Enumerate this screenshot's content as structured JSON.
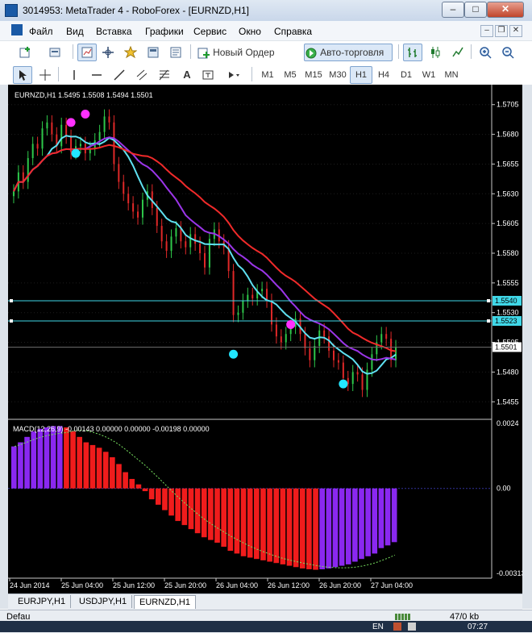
{
  "window": {
    "title": "3014953: MetaTrader 4 - RoboForex - [EURNZD,H1]",
    "controls": {
      "minimize": "–",
      "maximize": "□",
      "close": "✕"
    }
  },
  "menu": {
    "items": [
      "Файл",
      "Вид",
      "Вставка",
      "Графики",
      "Сервис",
      "Окно",
      "Справка"
    ],
    "mdi": {
      "minimize": "–",
      "restore": "❐",
      "close": "✕"
    }
  },
  "toolbar1": {
    "new_order": "Новый Ордер",
    "autotrade": "Авто-торговля"
  },
  "toolbar2": {
    "timeframes": [
      "M1",
      "M5",
      "M15",
      "M30",
      "H1",
      "H4",
      "D1",
      "W1",
      "MN"
    ],
    "active_timeframe": "H1",
    "text_tool": "A"
  },
  "chart": {
    "header": "EURNZD,H1  1.5495 1.5508 1.5494 1.5501",
    "price_axis": [
      "1.5705",
      "1.5680",
      "1.5655",
      "1.5630",
      "1.5605",
      "1.5580",
      "1.5555",
      "1.5530",
      "1.5505",
      "1.5480",
      "1.5455"
    ],
    "price_min": 1.5445,
    "price_max": 1.5715,
    "hlines": [
      {
        "price": 1.554,
        "label": "1.5540",
        "color": "#40d8e8"
      },
      {
        "price": 1.5523,
        "label": "1.5523",
        "color": "#40d8e8"
      }
    ],
    "current_price": {
      "price": 1.5501,
      "label": "1.5501"
    },
    "colors": {
      "bull": "#2ec84a",
      "bear": "#e02828",
      "ma_fast": "#5fe0f0",
      "ma_mid": "#9b35e8",
      "ma_slow": "#f02a2a",
      "dot_magenta": "#ff30ff",
      "dot_cyan": "#22e6ff"
    },
    "macd": {
      "header": "MACD(12,26,9) -0.00143 0.00000 0.00000 -0.00198 0.00000",
      "axis": [
        "0.0024",
        "0.00",
        "-0.00313"
      ],
      "colors": {
        "up": "#8a28f0",
        "down": "#f01c1c",
        "signal": "#78e060"
      }
    },
    "time_axis": [
      "24 Jun 2014",
      "25 Jun 04:00",
      "25 Jun 12:00",
      "25 Jun 20:00",
      "26 Jun 04:00",
      "26 Jun 12:00",
      "26 Jun 20:00",
      "27 Jun 04:00"
    ]
  },
  "chart_data": {
    "type": "candlestick",
    "symbol": "EURNZD",
    "timeframe": "H1",
    "ylim": [
      1.5445,
      1.5715
    ],
    "close": [
      1.5632,
      1.5648,
      1.564,
      1.566,
      1.5672,
      1.5668,
      1.5685,
      1.569,
      1.568,
      1.567,
      1.5688,
      1.5678,
      1.5665,
      1.567,
      1.5672,
      1.5664,
      1.5668,
      1.5675,
      1.5682,
      1.5695,
      1.569,
      1.5655,
      1.564,
      1.563,
      1.5622,
      1.5615,
      1.561,
      1.5625,
      1.5632,
      1.5618,
      1.5603,
      1.559,
      1.5582,
      1.5594,
      1.5601,
      1.559,
      1.5585,
      1.5596,
      1.5588,
      1.558,
      1.5568,
      1.5592,
      1.56,
      1.559,
      1.5585,
      1.5565,
      1.5528,
      1.553,
      1.554,
      1.5545,
      1.5542,
      1.5548,
      1.555,
      1.554,
      1.552,
      1.551,
      1.5505,
      1.5512,
      1.5518,
      1.5525,
      1.5512,
      1.55,
      1.549,
      1.5502,
      1.5515,
      1.551,
      1.5498,
      1.549,
      1.5488,
      1.5475,
      1.547,
      1.548,
      1.5478,
      1.5465,
      1.5482,
      1.5495,
      1.5505,
      1.5512,
      1.5508,
      1.549,
      1.5501
    ],
    "macd": [
      0.00155,
      0.0017,
      0.0019,
      0.0021,
      0.0022,
      0.00225,
      0.0023,
      0.0023,
      0.00225,
      0.0021,
      0.0019,
      0.0017,
      0.0016,
      0.0015,
      0.00135,
      0.00115,
      0.0009,
      0.0006,
      0.00035,
      0.00015,
      -0.0001,
      -0.0004,
      -0.0006,
      -0.0008,
      -0.001,
      -0.0012,
      -0.00135,
      -0.0015,
      -0.00165,
      -0.0018,
      -0.0019,
      -0.002,
      -0.00215,
      -0.0023,
      -0.0024,
      -0.0025,
      -0.00255,
      -0.0026,
      -0.00265,
      -0.0027,
      -0.00275,
      -0.0028,
      -0.00285,
      -0.0029,
      -0.00295,
      -0.00298,
      -0.003,
      -0.00298,
      -0.00295,
      -0.0029,
      -0.00285,
      -0.0028,
      -0.0027,
      -0.0026,
      -0.0025,
      -0.0024,
      -0.0022,
      -0.0021,
      -0.00198
    ],
    "macd_ylim": [
      -0.00313,
      0.0024
    ]
  },
  "tabs": [
    "EURJPY,H1",
    "USDJPY,H1",
    "EURNZD,H1"
  ],
  "active_tab": "EURNZD,H1",
  "status": {
    "left": "Defau",
    "traffic": "47/0 kb",
    "lang": "EN",
    "time": "07:27"
  }
}
